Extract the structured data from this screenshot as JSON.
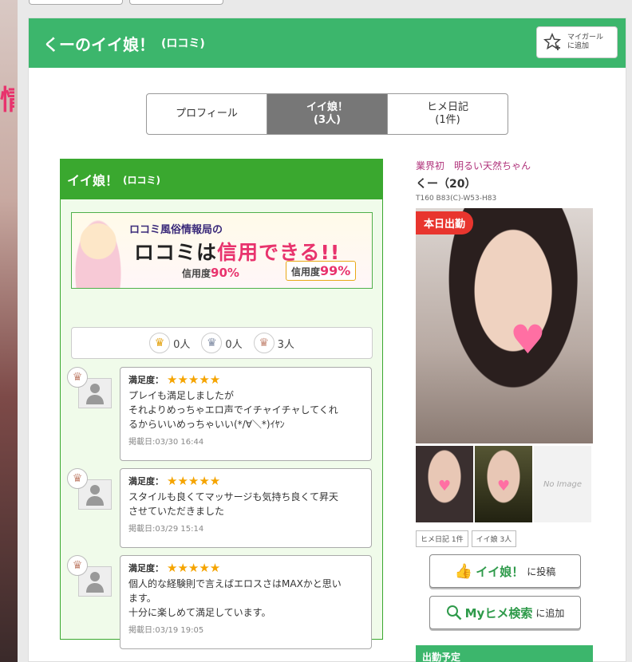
{
  "header": {
    "title": "くーのイイ娘！",
    "subtitle": "(ロコミ)",
    "mygirl_line1": "マイガール",
    "mygirl_line2": "に追加"
  },
  "tabs": [
    {
      "line1": "プロフィール",
      "line2": ""
    },
    {
      "line1": "イイ娘！",
      "line2": "(3人)"
    },
    {
      "line1": "ヒメ日記",
      "line2": "(1件)"
    }
  ],
  "reviews_box": {
    "title": "イイ娘！",
    "title_sub": "(ロコミ)"
  },
  "banner": {
    "tagline": "ロコミ風俗情報局の",
    "main_a": "ロコミ",
    "main_b": "は",
    "main_c": "信用できる!!",
    "silver_label": "信用度",
    "silver_value": "90%",
    "gold_label": "信用度",
    "gold_value": "99%"
  },
  "counts": {
    "gold": "0人",
    "silver": "0人",
    "bronze": "3人"
  },
  "satisfaction_label": "満足度：",
  "stars": "★★★★★",
  "reviews": [
    {
      "line1": "プレイも満足しましたが",
      "line2": "それよりめっちゃエロ声でイチャイチャしてくれ",
      "line3": "るからいいめっちゃいい(*/∀＼*)ｲﾔﾝ",
      "date": "掲載日:03/30 16:44"
    },
    {
      "line1": "スタイルも良くてマッサージも気持ち良くて昇天",
      "line2": "させていただきました",
      "line3": "",
      "date": "掲載日:03/29 15:14"
    },
    {
      "line1": "個人的な経験則で言えばエロスさはMAXかと思い",
      "line2": "ます。",
      "line3": "十分に楽しめて満足しています。",
      "date": "掲載日:03/19 19:05"
    }
  ],
  "girl": {
    "catch": "業界初　明るい天然ちゃん",
    "name": "くー（20）",
    "size": "T160 B83(C)-W53-H83",
    "today_badge": "本日出勤",
    "noimage": "No Image"
  },
  "mini": {
    "diary": "ヒメ日記 1件",
    "iimusume": "イイ娘 3人"
  },
  "buttons": {
    "post_big": "イイ娘！",
    "post_small": "に投稿",
    "search_big": "Myヒメ検索",
    "search_small": "に追加"
  },
  "shift_label": "出勤予定"
}
